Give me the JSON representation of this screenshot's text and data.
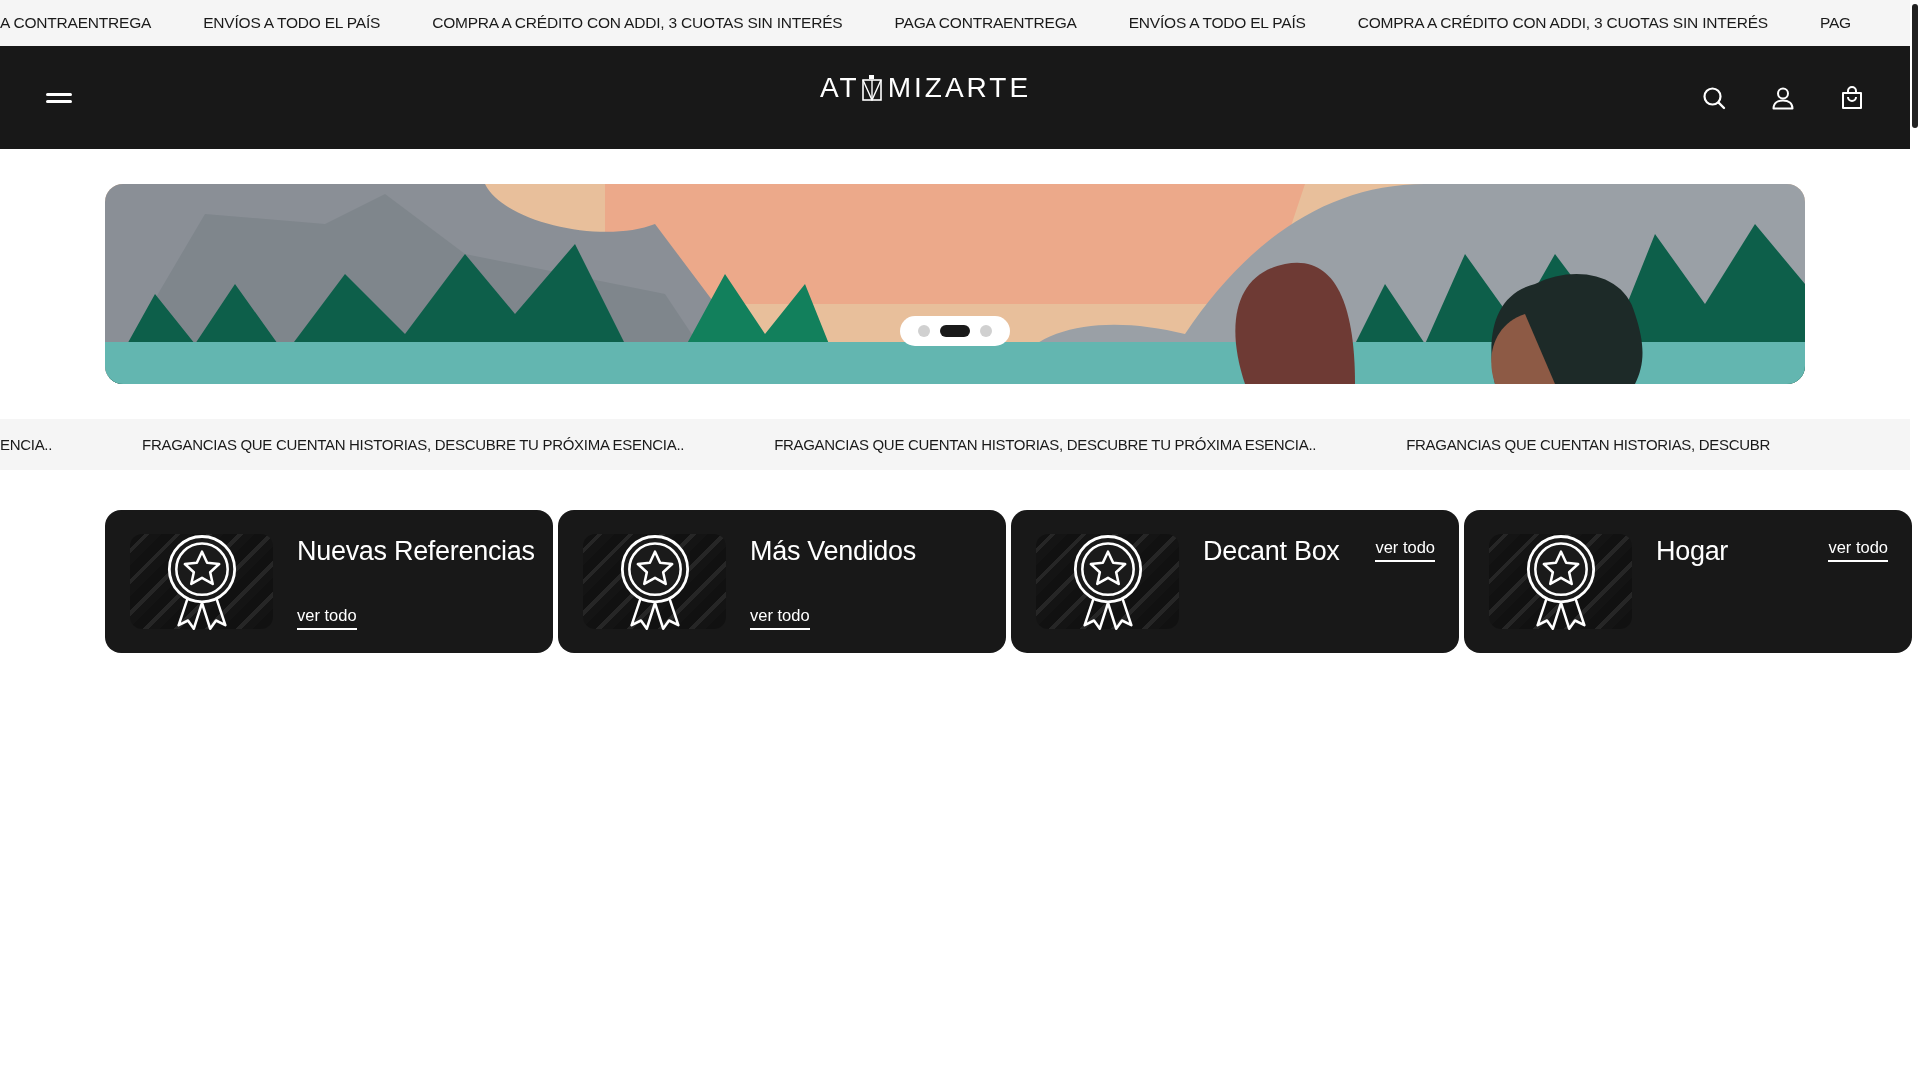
{
  "announcement_bar": {
    "items": [
      {
        "text": "A CONTRAENTREGA"
      },
      {
        "text": "ENVÍOS A TODO EL PAÍS"
      },
      {
        "text": "COMPRA A CRÉDITO CON ADDI, 3 CUOTAS SIN INTERÉS"
      },
      {
        "text": "PAGA CONTRAENTREGA"
      },
      {
        "text": "ENVÍOS A TODO EL PAÍS"
      },
      {
        "text": "COMPRA A CRÉDITO CON ADDI, 3 CUOTAS SIN INTERÉS"
      },
      {
        "text": "PAG"
      }
    ]
  },
  "header": {
    "logo": [
      "AT",
      "MIZARTE"
    ]
  },
  "slideshow": {
    "dots": [
      {
        "selected": false
      },
      {
        "selected": true
      },
      {
        "selected": false
      }
    ]
  },
  "ticker": {
    "items": [
      {
        "text": "ENCIA.."
      },
      {
        "text": "FRAGANCIAS QUE CUENTAN HISTORIAS, DESCUBRE TU PRÓXIMA ESENCIA.."
      },
      {
        "text": "FRAGANCIAS QUE CUENTAN HISTORIAS, DESCUBRE TU PRÓXIMA ESENCIA.."
      },
      {
        "text": "FRAGANCIAS QUE CUENTAN HISTORIAS, DESCUBR"
      }
    ]
  },
  "collections": [
    {
      "title": "Nuevas Referencias",
      "link": "ver todo",
      "kind": "below"
    },
    {
      "title": "Más Vendidos",
      "link": "ver todo",
      "kind": "below"
    },
    {
      "title": "Decant Box",
      "link": "ver todo",
      "kind": "beside"
    },
    {
      "title": "Hogar",
      "link": "ver todo",
      "kind": "beside"
    }
  ]
}
